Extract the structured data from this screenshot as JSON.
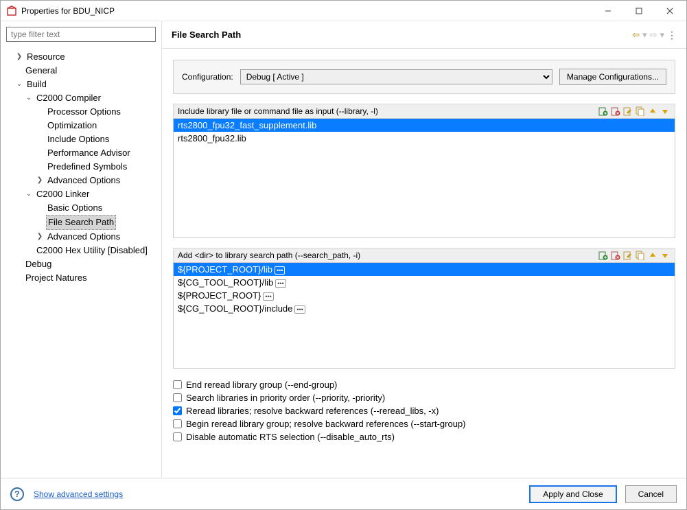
{
  "window": {
    "title": "Properties for BDU_NICP"
  },
  "sidebar": {
    "filter_placeholder": "type filter text",
    "tree": {
      "resource": "Resource",
      "general": "General",
      "build": "Build",
      "c2000_compiler": "C2000 Compiler",
      "processor_options": "Processor Options",
      "optimization": "Optimization",
      "include_options": "Include Options",
      "performance_advisor": "Performance Advisor",
      "predefined_symbols": "Predefined Symbols",
      "advanced_options_compiler": "Advanced Options",
      "c2000_linker": "C2000 Linker",
      "basic_options": "Basic Options",
      "file_search_path": "File Search Path",
      "advanced_options_linker": "Advanced Options",
      "hex_utility": "C2000 Hex Utility  [Disabled]",
      "debug": "Debug",
      "project_natures": "Project Natures"
    }
  },
  "header": {
    "title": "File Search Path"
  },
  "configuration": {
    "label": "Configuration:",
    "selected": "Debug  [ Active ]",
    "manage_button": "Manage Configurations..."
  },
  "library_files": {
    "title": "Include library file or command file as input (--library, -l)",
    "items": [
      {
        "text": "rts2800_fpu32_fast_supplement.lib",
        "selected": true
      },
      {
        "text": "rts2800_fpu32.lib",
        "selected": false
      }
    ]
  },
  "search_path": {
    "title": "Add <dir> to library search path (--search_path, -i)",
    "items": [
      {
        "text": "${PROJECT_ROOT}/lib",
        "var": true,
        "selected": true
      },
      {
        "text": "${CG_TOOL_ROOT}/lib",
        "var": true,
        "selected": false
      },
      {
        "text": "${PROJECT_ROOT}",
        "var": true,
        "selected": false
      },
      {
        "text": "${CG_TOOL_ROOT}/include",
        "var": true,
        "selected": false
      }
    ]
  },
  "checkboxes": {
    "end_group": {
      "label": "End reread library group (--end-group)",
      "checked": false
    },
    "priority": {
      "label": "Search libraries in priority order (--priority, -priority)",
      "checked": false
    },
    "reread": {
      "label": "Reread libraries; resolve backward references (--reread_libs, -x)",
      "checked": true
    },
    "start_group": {
      "label": "Begin reread library group; resolve backward references (--start-group)",
      "checked": false
    },
    "disable_auto_rts": {
      "label": "Disable automatic RTS selection (--disable_auto_rts)",
      "checked": false
    }
  },
  "footer": {
    "advanced_link": "Show advanced settings",
    "apply_close": "Apply and Close",
    "cancel": "Cancel"
  }
}
